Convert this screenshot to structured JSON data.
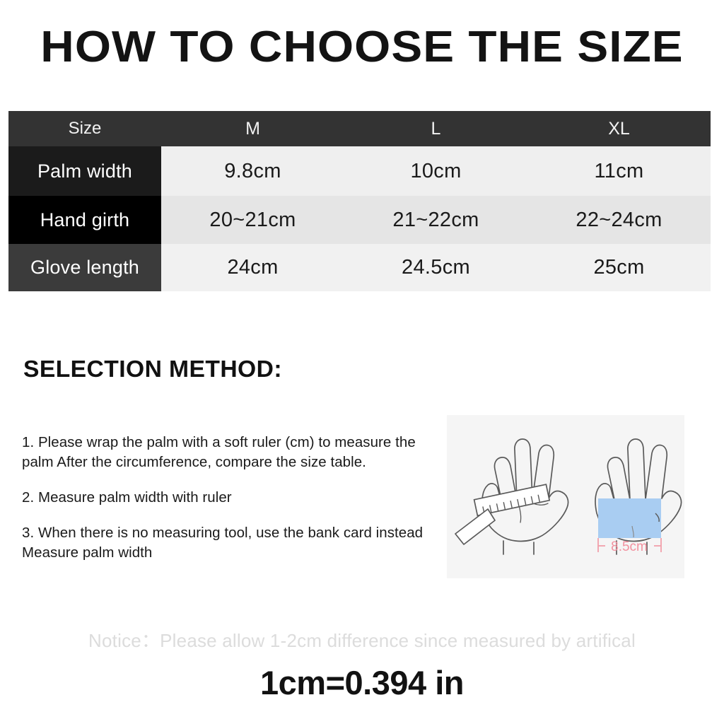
{
  "title": "HOW TO CHOOSE THE SIZE",
  "size_table": {
    "headers": [
      "Size",
      "M",
      "L",
      "XL"
    ],
    "rows": [
      {
        "label": "Palm width",
        "values": [
          "9.8cm",
          "10cm",
          "11cm"
        ]
      },
      {
        "label": "Hand girth",
        "values": [
          "20~21cm",
          "21~22cm",
          "22~24cm"
        ]
      },
      {
        "label": "Glove length",
        "values": [
          "24cm",
          "24.5cm",
          "25cm"
        ]
      }
    ]
  },
  "selection": {
    "heading": "SELECTION METHOD:",
    "steps": [
      "1. Please wrap the palm with a soft ruler (cm) to measure the palm After the circumference, compare the size table.",
      "2. Measure palm width with ruler",
      "3. When there is no measuring tool, use the bank card instead Measure palm width"
    ]
  },
  "illustration": {
    "card_measure_label": "8.5cm",
    "card_color": "#a9cdf2",
    "dimension_color": "#f2a0ab",
    "outline_color": "#5a5a5a",
    "panel_background": "#f5f5f5"
  },
  "notice": "Notice：Please allow 1-2cm difference since measured by artifical",
  "conversion": "1cm=0.394 in"
}
